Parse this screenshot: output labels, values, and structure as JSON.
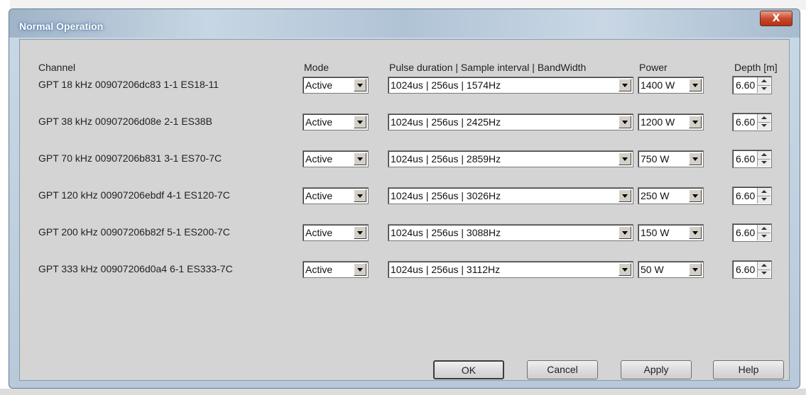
{
  "window": {
    "title": "Normal Operation",
    "close_glyph": "X"
  },
  "headers": {
    "channel": "Channel",
    "mode": "Mode",
    "pulse": "Pulse duration | Sample interval | BandWidth",
    "power": "Power",
    "depth": "Depth [m]"
  },
  "rows": [
    {
      "channel": "GPT  18 kHz 00907206dc83 1-1 ES18-11",
      "mode": "Active",
      "pulse": "1024us  |  256us  |  1574Hz",
      "power": "1400 W",
      "depth": "6.60"
    },
    {
      "channel": "GPT  38 kHz 00907206d08e 2-1 ES38B",
      "mode": "Active",
      "pulse": "1024us  |  256us  |  2425Hz",
      "power": "1200 W",
      "depth": "6.60"
    },
    {
      "channel": "GPT  70 kHz 00907206b831 3-1 ES70-7C",
      "mode": "Active",
      "pulse": "1024us  |  256us  |  2859Hz",
      "power": "750 W",
      "depth": "6.60"
    },
    {
      "channel": "GPT 120 kHz 00907206ebdf 4-1 ES120-7C",
      "mode": "Active",
      "pulse": "1024us  |  256us  |  3026Hz",
      "power": "250 W",
      "depth": "6.60"
    },
    {
      "channel": "GPT 200 kHz 00907206b82f 5-1 ES200-7C",
      "mode": "Active",
      "pulse": "1024us  |  256us  |  3088Hz",
      "power": "150 W",
      "depth": "6.60"
    },
    {
      "channel": "GPT 333 kHz 00907206d0a4 6-1 ES333-7C",
      "mode": "Active",
      "pulse": "1024us  |  256us  |  3112Hz",
      "power": "50 W",
      "depth": "6.60"
    }
  ],
  "buttons": {
    "ok": "OK",
    "cancel": "Cancel",
    "apply": "Apply",
    "help": "Help"
  }
}
